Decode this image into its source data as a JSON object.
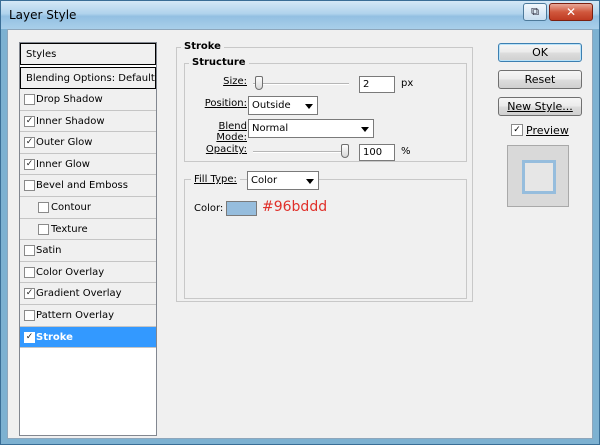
{
  "window": {
    "title": "Layer Style",
    "help_glyph": "⧉",
    "close_glyph": "✕"
  },
  "styles_panel": {
    "header": "Styles",
    "blending": "Blending Options: Default",
    "items": [
      {
        "label": "Drop Shadow",
        "checked": false,
        "sub": false,
        "selected": false
      },
      {
        "label": "Inner Shadow",
        "checked": true,
        "sub": false,
        "selected": false
      },
      {
        "label": "Outer Glow",
        "checked": true,
        "sub": false,
        "selected": false
      },
      {
        "label": "Inner Glow",
        "checked": true,
        "sub": false,
        "selected": false
      },
      {
        "label": "Bevel and Emboss",
        "checked": false,
        "sub": false,
        "selected": false
      },
      {
        "label": "Contour",
        "checked": false,
        "sub": true,
        "selected": false
      },
      {
        "label": "Texture",
        "checked": false,
        "sub": true,
        "selected": false
      },
      {
        "label": "Satin",
        "checked": false,
        "sub": false,
        "selected": false
      },
      {
        "label": "Color Overlay",
        "checked": false,
        "sub": false,
        "selected": false
      },
      {
        "label": "Gradient Overlay",
        "checked": true,
        "sub": false,
        "selected": false
      },
      {
        "label": "Pattern Overlay",
        "checked": false,
        "sub": false,
        "selected": false
      },
      {
        "label": "Stroke",
        "checked": true,
        "sub": false,
        "selected": true
      }
    ]
  },
  "stroke": {
    "title": "Stroke",
    "structure_title": "Structure",
    "size_label": "Size:",
    "size_value": "2",
    "size_unit": "px",
    "size_fraction": 0.02,
    "position_label": "Position:",
    "position_value": "Outside",
    "blend_label": "Blend Mode:",
    "blend_value": "Normal",
    "opacity_label": "Opacity:",
    "opacity_value": "100",
    "opacity_unit": "%",
    "opacity_fraction": 1.0,
    "fill_type_label": "Fill Type:",
    "fill_type_value": "Color",
    "color_label": "Color:",
    "color_hex": "#96bddd"
  },
  "buttons": {
    "ok": "OK",
    "reset": "Reset",
    "new_style": "New Style...",
    "preview_label": "Preview",
    "preview_checked": true
  },
  "colors": {
    "swatch": "#96bddd",
    "selection": "#3399ff",
    "hex_text": "#e0302a"
  }
}
